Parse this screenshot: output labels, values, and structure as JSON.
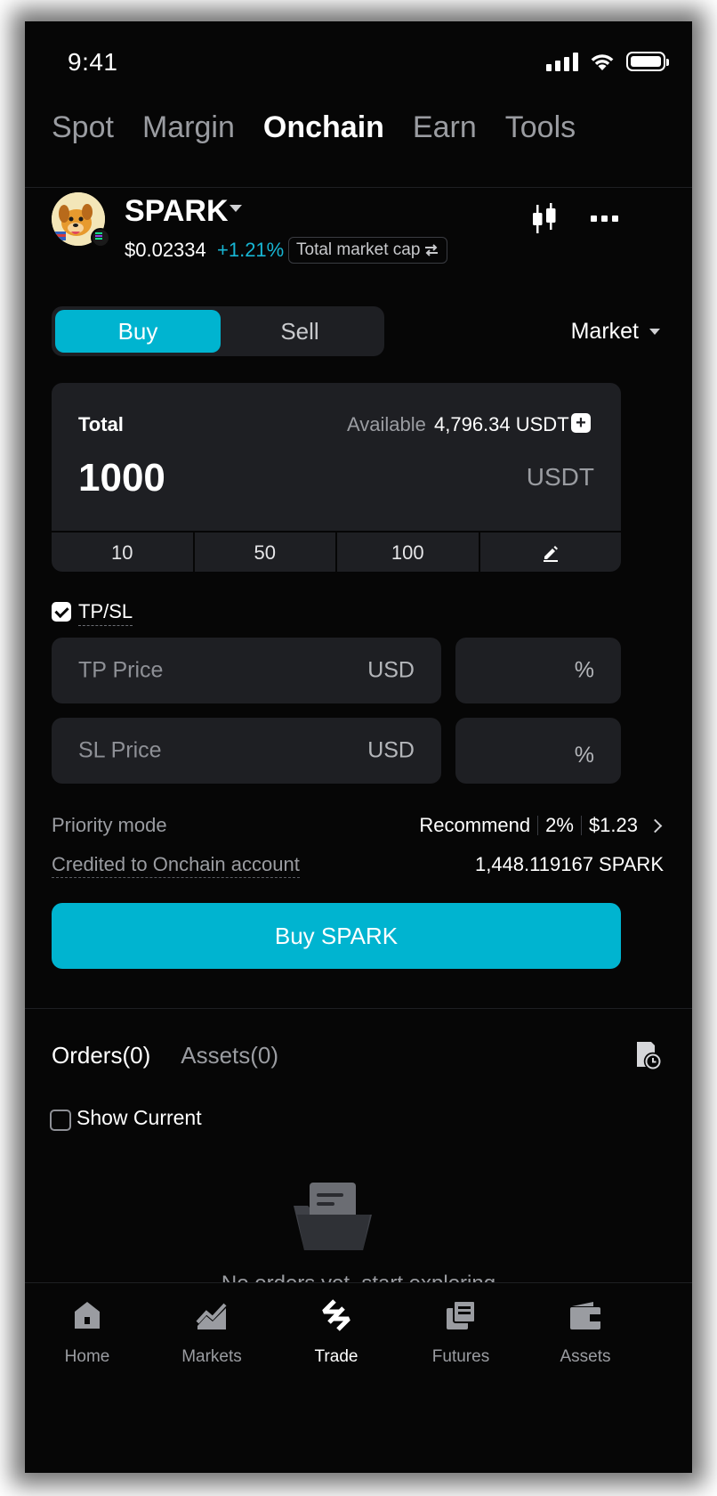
{
  "status_bar": {
    "time": "9:41"
  },
  "top_tabs": [
    {
      "label": "Spot",
      "active": false
    },
    {
      "label": "Margin",
      "active": false
    },
    {
      "label": "Onchain",
      "active": true
    },
    {
      "label": "Earn",
      "active": false
    },
    {
      "label": "Tools",
      "active": false
    }
  ],
  "token": {
    "name": "SPARK",
    "price": "$0.02334",
    "change": "+1.21%",
    "market_cap_label": "Total market cap"
  },
  "trade": {
    "buy_label": "Buy",
    "sell_label": "Sell",
    "order_type": "Market",
    "total_label": "Total",
    "available_label": "Available",
    "available_value": "4,796.34 USDT",
    "amount": "1000",
    "amount_unit": "USDT",
    "presets": [
      "10",
      "50",
      "100"
    ],
    "tpsl_label": "TP/SL",
    "tpsl_checked": true,
    "tp_placeholder": "TP Price",
    "tp_unit": "USD",
    "tp_pct_unit": "%",
    "sl_placeholder": "SL Price",
    "sl_unit": "USD",
    "sl_pct_unit": "%",
    "priority_label": "Priority mode",
    "priority_mode": "Recommend",
    "priority_slippage": "2%",
    "priority_fee": "$1.23",
    "credited_label": "Credited to Onchain account",
    "credited_value": "1,448.119167 SPARK",
    "cta_label": "Buy SPARK"
  },
  "orders": {
    "tabs": [
      {
        "label": "Orders(0)",
        "active": true
      },
      {
        "label": "Assets(0)",
        "active": false
      }
    ],
    "show_current_label": "Show Current",
    "empty_text": "No orders yet, start exploring"
  },
  "bottom_nav": [
    {
      "label": "Home",
      "icon": "home-icon",
      "active": false
    },
    {
      "label": "Markets",
      "icon": "markets-icon",
      "active": false
    },
    {
      "label": "Trade",
      "icon": "trade-icon",
      "active": true
    },
    {
      "label": "Futures",
      "icon": "futures-icon",
      "active": false
    },
    {
      "label": "Assets",
      "icon": "wallet-icon",
      "active": false
    }
  ],
  "colors": {
    "accent": "#00b4d0",
    "positive": "#17b6d4",
    "background": "#060606",
    "surface": "#1e1f23"
  }
}
